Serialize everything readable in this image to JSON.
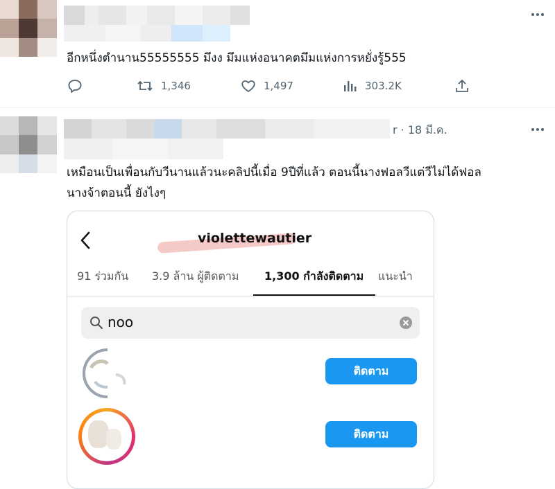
{
  "tweet1": {
    "text": "อีกหนึ่งตำนาน55555555 มึงง มึมแห่งอนาคตมึมแห่งการหยั่งรู้555",
    "actions": {
      "retweets": "1,346",
      "likes": "1,497",
      "views": "303.2K"
    }
  },
  "tweet2": {
    "date_fragment": "r · 18 มี.ค.",
    "text_line1": "เหมือนเป็นเพื่อนกับวีนานแล้วนะคลิปนี้เมื่อ 9ปีที่แล้ว ตอนนี้นางฟอลวีแต่วีไม่ได้ฟอล",
    "text_line2": "นางจ้าตอนนี้ ยังไงๆ"
  },
  "screenshot": {
    "username": "violettewautier",
    "tabs": [
      "91 ร่วมกัน",
      "3.9 ล้าน ผู้ติดตาม",
      "1,300 กำลังติดตาม",
      "แนะนำ"
    ],
    "search_value": "noo",
    "follow_label": "ติดตาม"
  },
  "colors": {
    "accent": "#1a97f0",
    "muted": "#536471"
  }
}
